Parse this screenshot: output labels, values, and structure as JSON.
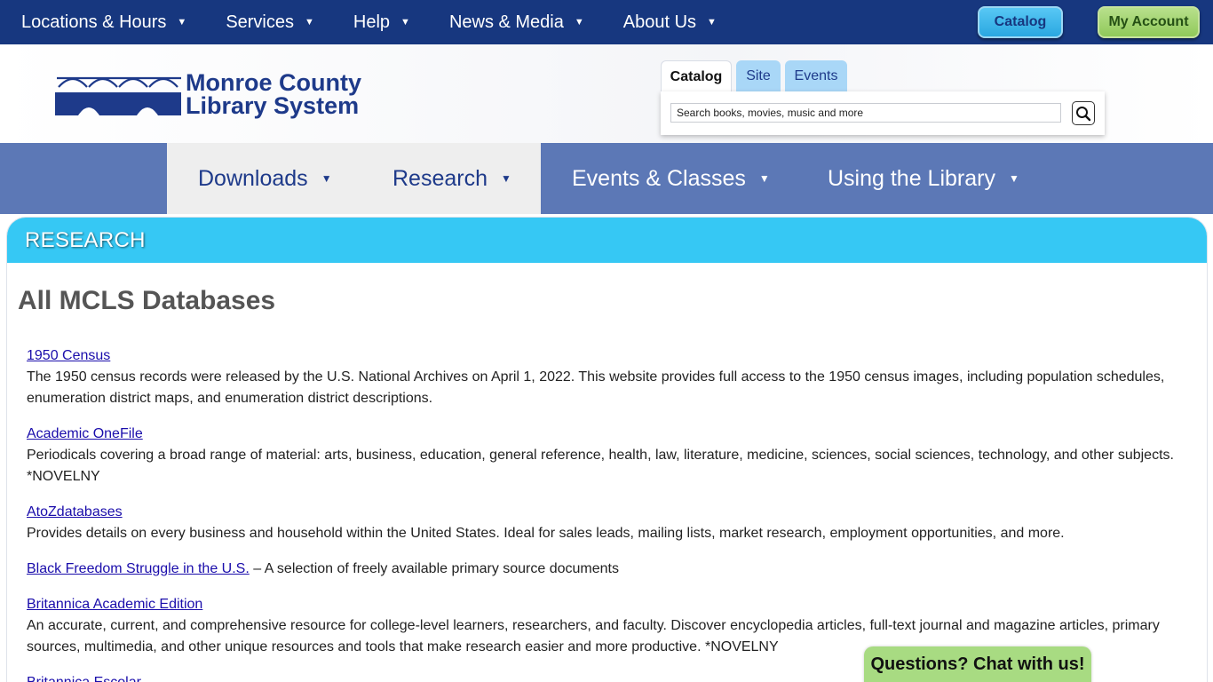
{
  "top_nav": {
    "items": [
      {
        "label": "Locations & Hours"
      },
      {
        "label": "Services"
      },
      {
        "label": "Help"
      },
      {
        "label": "News & Media"
      },
      {
        "label": "About Us"
      }
    ],
    "catalog_button": "Catalog",
    "account_button": "My Account"
  },
  "logo": {
    "line1": "Monroe County",
    "line2": "Library System"
  },
  "search": {
    "tabs": [
      {
        "label": "Catalog",
        "active": true
      },
      {
        "label": "Site",
        "active": false
      },
      {
        "label": "Events",
        "active": false
      }
    ],
    "placeholder": "Search books, movies, music and more"
  },
  "main_nav": {
    "items": [
      {
        "label": "Downloads"
      },
      {
        "label": "Research"
      },
      {
        "label": "Events & Classes"
      },
      {
        "label": "Using the Library"
      }
    ]
  },
  "section": {
    "header": "RESEARCH",
    "title": "All MCLS Databases"
  },
  "databases": [
    {
      "name": "1950 Census",
      "desc": "The 1950 census records were released by the U.S. National Archives on April 1, 2022. This website provides full access to the 1950 census images, including population schedules, enumeration district maps, and enumeration district descriptions."
    },
    {
      "name": "Academic OneFile",
      "desc": "Periodicals covering a broad range of material: arts, business, education, general reference, health, law, literature, medicine, sciences, social sciences, technology, and other subjects. *NOVELNY"
    },
    {
      "name": "AtoZdatabases",
      "desc": "Provides details on every business and household within the United States. Ideal for sales leads, mailing lists, market research, employment opportunities, and more."
    },
    {
      "name": "Black Freedom Struggle in the U.S.",
      "inline": " – A selection of freely available primary source documents"
    },
    {
      "name": "Britannica Academic Edition",
      "desc": "An accurate, current, and comprehensive resource for college-level learners, researchers, and faculty. Discover encyclopedia articles, full-text journal and magazine articles, primary sources, multimedia, and other unique resources and tools that make research easier and more productive. *NOVELNY"
    },
    {
      "name": "Britannica Escolar",
      "desc": ""
    }
  ],
  "chat": {
    "label": "Questions? Chat with us!"
  },
  "colors": {
    "top_bar": "#17377f",
    "main_nav": "#5c78b6",
    "section_header": "#36c8f4",
    "chat": "#a8db82",
    "link": "#1a0dab"
  }
}
